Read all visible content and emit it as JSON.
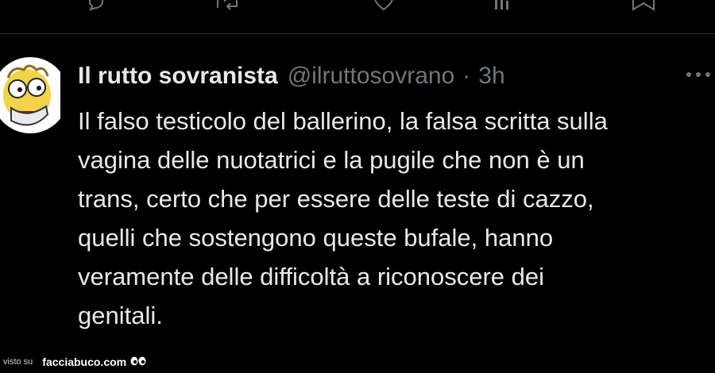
{
  "tweet": {
    "display_name": "Il rutto sovranista",
    "handle": "@ilruttosovrano",
    "separator": "·",
    "time": "3h",
    "body_lines": [
      "Il falso testicolo del ballerino, la falsa scritta sulla",
      "vagina delle nuotatrici e la pugile che non è un",
      "trans, certo che per essere delle teste di cazzo,",
      "quelli che sostengono queste bufale, hanno",
      "veramente delle difficoltà a riconoscere dei",
      "genitali."
    ],
    "avatar_icon": "cartoon-character-avatar"
  },
  "top_actions": {
    "icons": [
      "reply-icon",
      "retweet-icon",
      "like-icon",
      "views-icon",
      "bookmark-icon"
    ]
  },
  "more_icon": "more-options-icon",
  "watermark": {
    "label": "visto su",
    "brand": "facciabuco.com",
    "logo_icon": "eyes-logo-icon"
  },
  "colors": {
    "background": "#000000",
    "primary_text": "#e7e9ea",
    "secondary_text": "#71767b",
    "divider": "#2f3336",
    "avatar_skin": "#f2d34a"
  }
}
